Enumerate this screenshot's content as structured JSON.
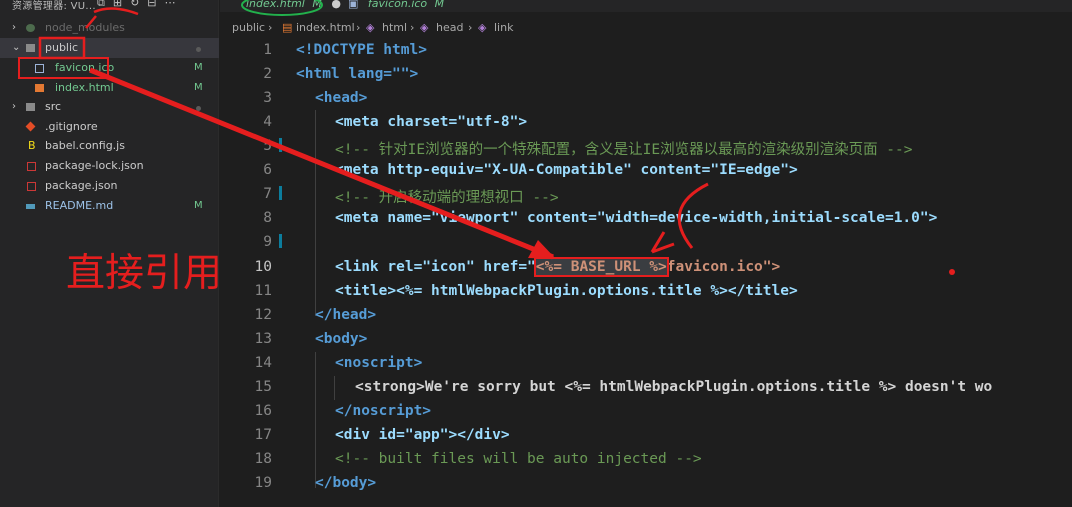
{
  "sidebar": {
    "header_title": "资源管理器: VU...",
    "items": [
      {
        "label": "node_modules",
        "type": "folder"
      },
      {
        "label": "public",
        "type": "folder"
      },
      {
        "label": "favicon.ico",
        "badge": "M",
        "type": "file"
      },
      {
        "label": "index.html",
        "badge": "M",
        "type": "file"
      },
      {
        "label": "src",
        "type": "folder"
      },
      {
        "label": ".gitignore",
        "type": "file"
      },
      {
        "label": "babel.config.js",
        "type": "file"
      },
      {
        "label": "package-lock.json",
        "type": "file"
      },
      {
        "label": "package.json",
        "type": "file"
      },
      {
        "label": "README.md",
        "badge": "M",
        "type": "file"
      }
    ]
  },
  "tabs": [
    {
      "label": "index.html",
      "badge": "M",
      "modified_dot": "●"
    },
    {
      "label": "favicon.ico",
      "badge": "M"
    }
  ],
  "breadcrumb": [
    "public",
    "index.html",
    "html",
    "head",
    "link"
  ],
  "annotation": {
    "text": "直接引用"
  },
  "lines": {
    "n1": "1",
    "n2": "2",
    "n3": "3",
    "n4": "4",
    "n5": "5",
    "n6": "6",
    "n7": "7",
    "n8": "8",
    "n9": "9",
    "n10": "10",
    "n11": "11",
    "n12": "12",
    "n13": "13",
    "n14": "14",
    "n15": "15",
    "n16": "16",
    "n17": "17",
    "n18": "18",
    "n19": "19",
    "l1_doctype": "<!DOCTYPE html>",
    "l2_html_open": "<html lang=\"\">",
    "l3_head_open": "<head>",
    "l4_meta_charset": "<meta charset=\"utf-8\">",
    "l5_comment": "<!-- 针对IE浏览器的一个特殊配置，含义是让IE浏览器以最高的渲染级别渲染页面 -->",
    "l6_meta_xua": "<meta http-equiv=\"X-UA-Compatible\" content=\"IE=edge\">",
    "l7_comment": "<!-- 开启移动端的理想视口 -->",
    "l8_meta_viewport": "<meta name=\"viewport\" content=\"width=device-width,initial-scale=1.0\">",
    "l10_link_pre": "<link rel=\"icon\" href=\"",
    "l10_base_url": "<%= BASE_URL %>",
    "l10_link_post": "favicon.ico\">",
    "l11_title": "<title><%= htmlWebpackPlugin.options.title %></title>",
    "l12_head_close": "</head>",
    "l13_body_open": "<body>",
    "l14_noscript_open": "<noscript>",
    "l15_strong": "<strong>We're sorry but <%= htmlWebpackPlugin.options.title %> doesn't wo",
    "l16_noscript_close": "</noscript>",
    "l17_div_app": "<div id=\"app\"></div>",
    "l18_comment": "<!-- built files will be auto injected -->",
    "l19_body_close": "</body>"
  },
  "colors": {
    "annotation_red": "#e51e1e",
    "modified_green": "#73c991",
    "editor_bg": "#1e1e1e",
    "sidebar_bg": "#252526"
  }
}
